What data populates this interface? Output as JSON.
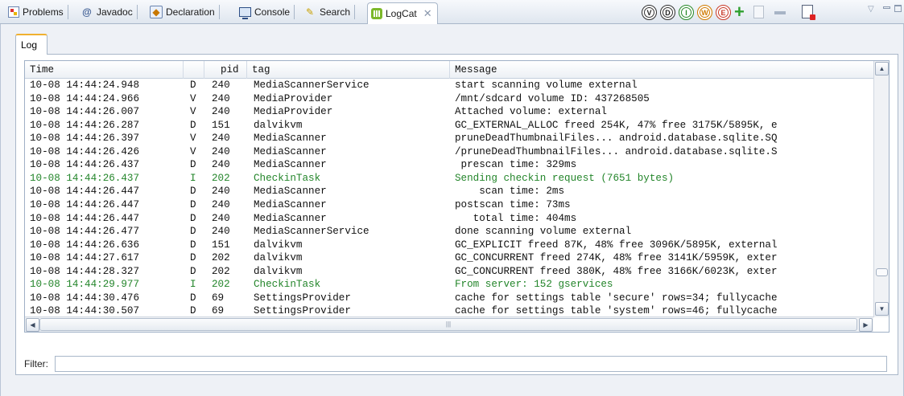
{
  "view_tabs": [
    {
      "label": "Problems",
      "icon": "problems-icon"
    },
    {
      "label": "Javadoc",
      "icon": "javadoc-icon"
    },
    {
      "label": "Declaration",
      "icon": "declaration-icon"
    },
    {
      "label": "Console",
      "icon": "console-icon"
    },
    {
      "label": "Search",
      "icon": "search-icon"
    },
    {
      "label": "LogCat",
      "icon": "logcat-icon",
      "active": true
    }
  ],
  "toolbar": {
    "level_filters": [
      "V",
      "D",
      "I",
      "W",
      "E"
    ],
    "add_filter": "+",
    "level_colors": {
      "info": "#23852a",
      "warn": "#d07a00",
      "error": "#c83a2a"
    }
  },
  "subtab": {
    "label": "Log"
  },
  "table": {
    "columns": [
      "Time",
      "",
      "pid",
      "tag",
      "Message"
    ],
    "rows": [
      {
        "time": "10-08 14:44:24.948",
        "level": "D",
        "pid": "240",
        "tag": "MediaScannerService",
        "message": "start scanning volume external"
      },
      {
        "time": "10-08 14:44:24.966",
        "level": "V",
        "pid": "240",
        "tag": "MediaProvider",
        "message": "/mnt/sdcard volume ID: 437268505"
      },
      {
        "time": "10-08 14:44:26.007",
        "level": "V",
        "pid": "240",
        "tag": "MediaProvider",
        "message": "Attached volume: external"
      },
      {
        "time": "10-08 14:44:26.287",
        "level": "D",
        "pid": "151",
        "tag": "dalvikvm",
        "message": "GC_EXTERNAL_ALLOC freed 254K, 47% free 3175K/5895K, e"
      },
      {
        "time": "10-08 14:44:26.397",
        "level": "V",
        "pid": "240",
        "tag": "MediaScanner",
        "message": "pruneDeadThumbnailFiles... android.database.sqlite.SQ"
      },
      {
        "time": "10-08 14:44:26.426",
        "level": "V",
        "pid": "240",
        "tag": "MediaScanner",
        "message": "/pruneDeadThumbnailFiles... android.database.sqlite.S"
      },
      {
        "time": "10-08 14:44:26.437",
        "level": "D",
        "pid": "240",
        "tag": "MediaScanner",
        "message": " prescan time: 329ms"
      },
      {
        "time": "10-08 14:44:26.437",
        "level": "I",
        "pid": "202",
        "tag": "CheckinTask",
        "message": "Sending checkin request (7651 bytes)"
      },
      {
        "time": "10-08 14:44:26.447",
        "level": "D",
        "pid": "240",
        "tag": "MediaScanner",
        "message": "    scan time: 2ms"
      },
      {
        "time": "10-08 14:44:26.447",
        "level": "D",
        "pid": "240",
        "tag": "MediaScanner",
        "message": "postscan time: 73ms"
      },
      {
        "time": "10-08 14:44:26.447",
        "level": "D",
        "pid": "240",
        "tag": "MediaScanner",
        "message": "   total time: 404ms"
      },
      {
        "time": "10-08 14:44:26.477",
        "level": "D",
        "pid": "240",
        "tag": "MediaScannerService",
        "message": "done scanning volume external"
      },
      {
        "time": "10-08 14:44:26.636",
        "level": "D",
        "pid": "151",
        "tag": "dalvikvm",
        "message": "GC_EXPLICIT freed 87K, 48% free 3096K/5895K, external"
      },
      {
        "time": "10-08 14:44:27.617",
        "level": "D",
        "pid": "202",
        "tag": "dalvikvm",
        "message": "GC_CONCURRENT freed 274K, 48% free 3141K/5959K, exter"
      },
      {
        "time": "10-08 14:44:28.327",
        "level": "D",
        "pid": "202",
        "tag": "dalvikvm",
        "message": "GC_CONCURRENT freed 380K, 48% free 3166K/6023K, exter"
      },
      {
        "time": "10-08 14:44:29.977",
        "level": "I",
        "pid": "202",
        "tag": "CheckinTask",
        "message": "From server: 152 gservices"
      },
      {
        "time": "10-08 14:44:30.476",
        "level": "D",
        "pid": "69",
        "tag": "SettingsProvider",
        "message": "cache for settings table 'secure' rows=34; fullycache"
      },
      {
        "time": "10-08 14:44:30.507",
        "level": "D",
        "pid": "69",
        "tag": "SettingsProvider",
        "message": "cache for settings table 'system' rows=46; fullycache"
      }
    ]
  },
  "filter": {
    "label": "Filter:",
    "value": ""
  }
}
